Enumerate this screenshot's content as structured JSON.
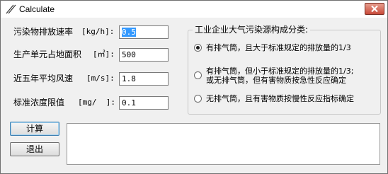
{
  "window": {
    "title": "Calculate"
  },
  "fields": [
    {
      "label": "污染物排放速率",
      "unit": "[kg/h]:",
      "value": "0.5"
    },
    {
      "label": "生产单元占地面积",
      "unit": "[㎡]:",
      "value": "500"
    },
    {
      "label": "近五年平均风速",
      "unit": "[m/s]:",
      "value": "1.8"
    },
    {
      "label": "标准浓度限值",
      "unit": "[mg/  ]:",
      "value": "0.1"
    }
  ],
  "source_group": {
    "title": "工业企业大气污染源构成分类:",
    "options": [
      {
        "lines": [
          "有排气筒，且大于标准规定的排放量的1/3"
        ],
        "checked": true
      },
      {
        "lines": [
          "有排气筒，但小于标准规定的排放量的1/3;",
          "或无排气筒，但有害物质按急性反应确定"
        ],
        "checked": false
      },
      {
        "lines": [
          "无排气筒，且有害物质按慢性反应指标确定"
        ],
        "checked": false
      }
    ]
  },
  "buttons": {
    "calculate": "计算",
    "exit": "退出"
  },
  "output": {
    "text": ""
  }
}
